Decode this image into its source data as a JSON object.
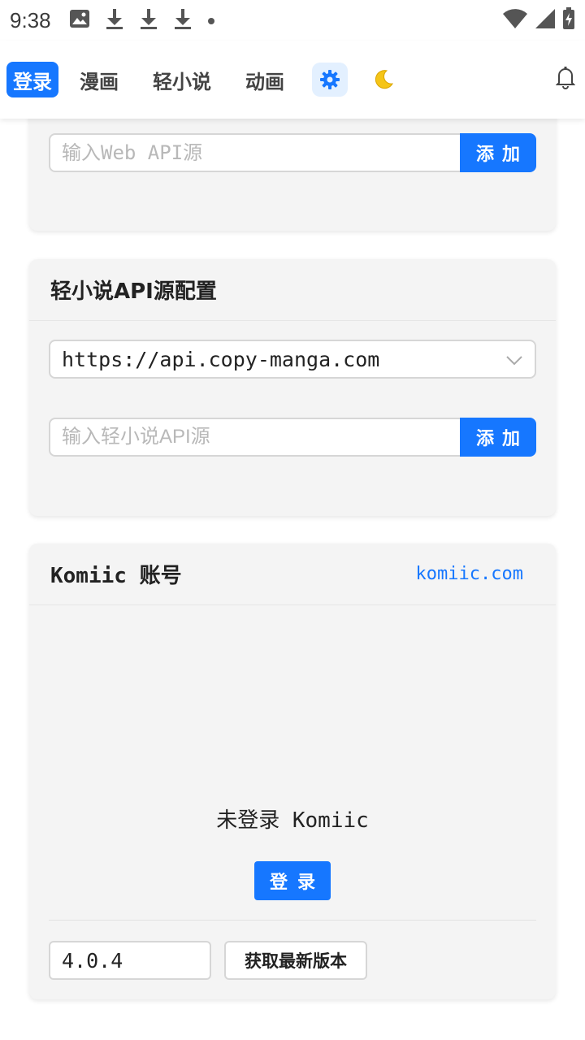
{
  "status_bar": {
    "time": "9:38",
    "icons": [
      "image-icon",
      "download-icon",
      "download-icon",
      "download-icon",
      "dot-icon",
      "wifi-icon",
      "signal-icon",
      "battery-icon"
    ]
  },
  "nav": {
    "tabs": [
      {
        "label": "登录",
        "active": true
      },
      {
        "label": "漫画",
        "active": false
      },
      {
        "label": "轻小说",
        "active": false
      },
      {
        "label": "动画",
        "active": false
      }
    ],
    "icons": [
      "gear-icon",
      "moon-icon",
      "bell-icon"
    ],
    "accent_color": "#1677ff"
  },
  "web_api_card": {
    "input_placeholder": "输入Web API源",
    "add_label": "添加"
  },
  "novel_api_card": {
    "title": "轻小说API源配置",
    "selected_source": "https://api.copy-manga.com",
    "input_placeholder": "输入轻小说API源",
    "add_label": "添加"
  },
  "komiic_card": {
    "title": "Komiic 账号",
    "link": "komiic.com",
    "status_text": "未登录 Komiic",
    "login_label": "登录",
    "version": "4.0.4",
    "fetch_label": "获取最新版本"
  }
}
